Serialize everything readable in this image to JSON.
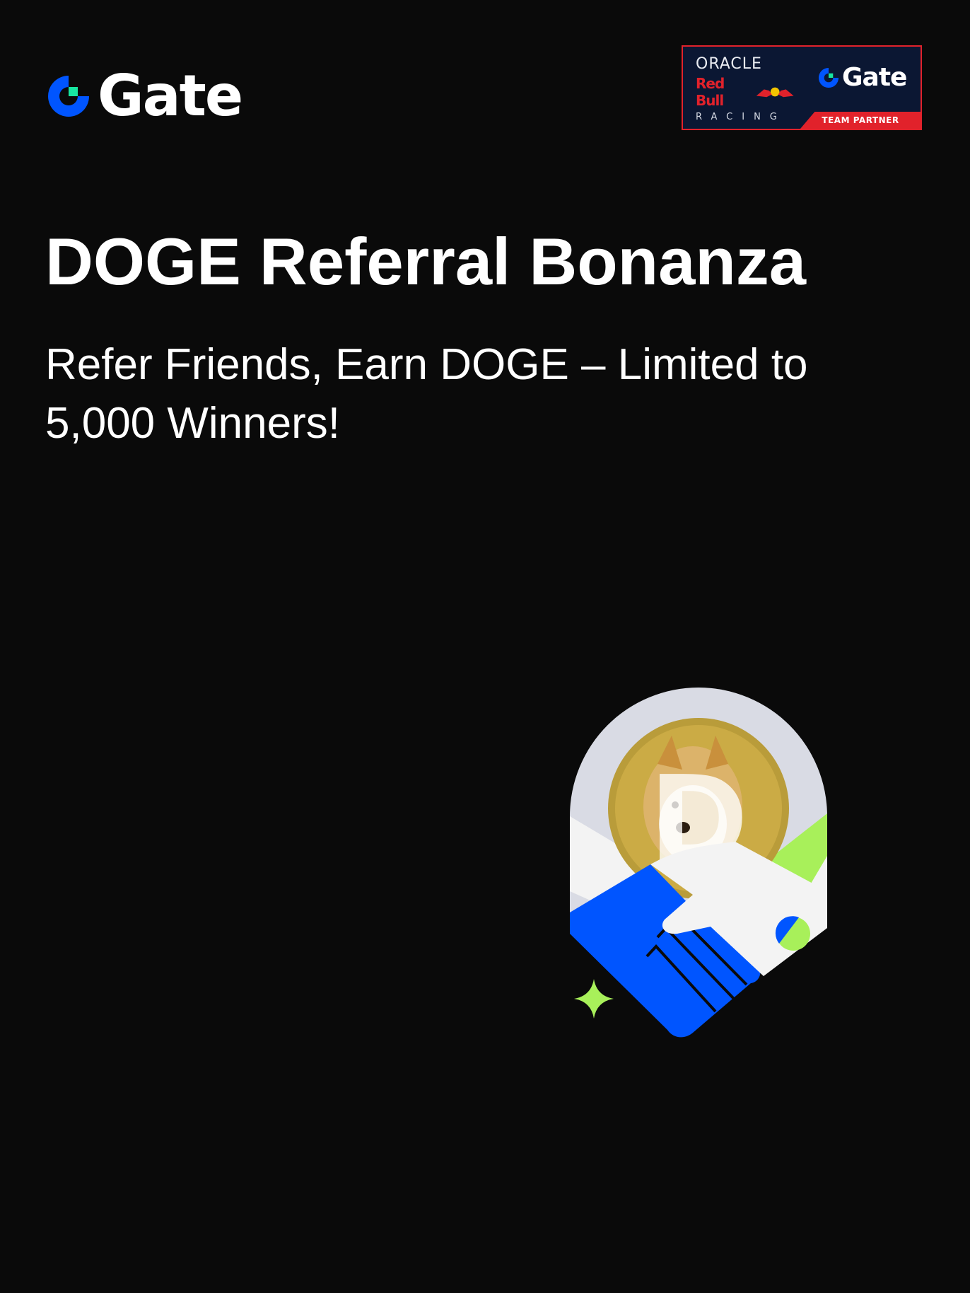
{
  "header": {
    "logo_text": "Gate",
    "partner_badge": {
      "oracle_text": "ORACLE",
      "redbull_text": "Red Bull",
      "racing_text": "RACING",
      "gate_text": "Gate",
      "ribbon_text": "TEAM PARTNER"
    }
  },
  "promo": {
    "title": "DOGE Referral Bonanza",
    "subtitle": "Refer Friends, Earn DOGE – Limited to 5,000 Winners!"
  },
  "illustration": {
    "coin_letter": "D",
    "icons": [
      "handshake-icon",
      "doge-coin-icon",
      "sparkle-icon"
    ]
  },
  "colors": {
    "background": "#0a0a0a",
    "brand_blue": "#0055ff",
    "brand_green": "#17e6a1",
    "accent_lime": "#a8f05a",
    "doge_gold": "#c9a93a",
    "partner_red": "#e1222b",
    "partner_navy": "#0b1733"
  }
}
